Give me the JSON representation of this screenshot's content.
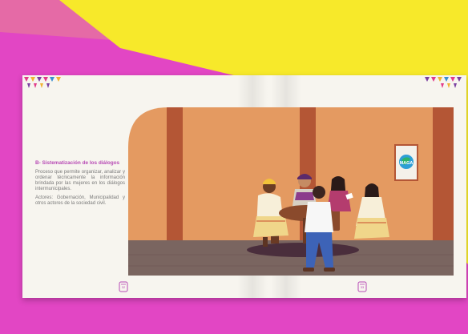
{
  "colors": {
    "magenta": "#e246c4",
    "yellow": "#f7e92a",
    "page": "#f7f5ef",
    "wall": "#e49a61",
    "pillar": "#b45635",
    "floor": "#7a6560",
    "title_accent": "#b74ab5"
  },
  "left_page": {
    "title": "B- Sistematización de los diálogos",
    "paragraph": "Proceso que permite organizar, analizar y ordenar técnicamente la información brindada por las mujeres en los diálogos intermunicipales.",
    "actors": "Actores: Gobernación, Municipalidad y otros actores de la sociedad civil."
  },
  "right_page": {
    "sign_text": "MAGA"
  },
  "page_numbers": {
    "left": "32",
    "right": "33"
  }
}
